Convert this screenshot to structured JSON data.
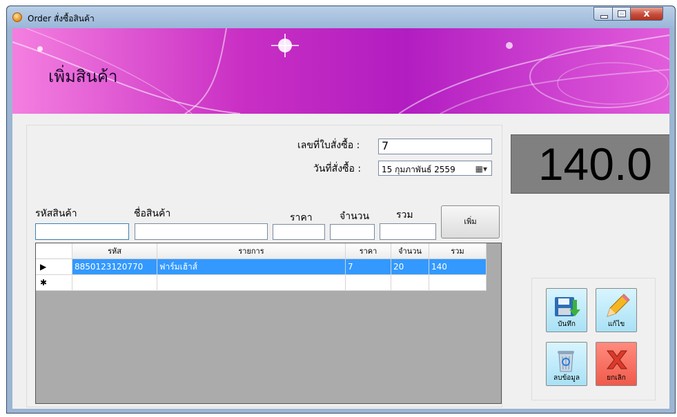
{
  "window": {
    "title": "Order สั่งซื้อสินค้า",
    "close_glyph": "x"
  },
  "banner": {
    "title": "เพิ่มสินค้า"
  },
  "order": {
    "order_no_label": "เลขที่ใบสั่งซื้อ :",
    "order_no_value": "7",
    "date_label": "วันที่สั่งซื้อ :",
    "date_value": "15 กุมภาพันธ์ 2559"
  },
  "entry": {
    "code_label": "รหัสสินค้า",
    "name_label": "ชื่อสินค้า",
    "price_label": "ราคา",
    "qty_label": "จำนวน",
    "sum_label": "รวม",
    "add_button": "เพิ่ม"
  },
  "grid": {
    "columns": [
      "รหัส",
      "รายการ",
      "ราคา",
      "จำนวน",
      "รวม"
    ],
    "rows": [
      {
        "code": "8850123120770",
        "name": "ฟาร์มเฮ้าส์",
        "price": "7",
        "qty": "20",
        "sum": "140"
      }
    ],
    "row_marker": "▶",
    "new_row_marker": "✱"
  },
  "total": {
    "value": "140.0"
  },
  "actions": {
    "save": "บันทึก",
    "edit": "แก้ไข",
    "delete": "ลบข้อมูล",
    "cancel": "ยกเลิก"
  },
  "colors": {
    "banner": "#c92fc4",
    "selected_row": "#3399ff",
    "total_bg": "#808080",
    "cancel_bg": "#f05a4b"
  }
}
